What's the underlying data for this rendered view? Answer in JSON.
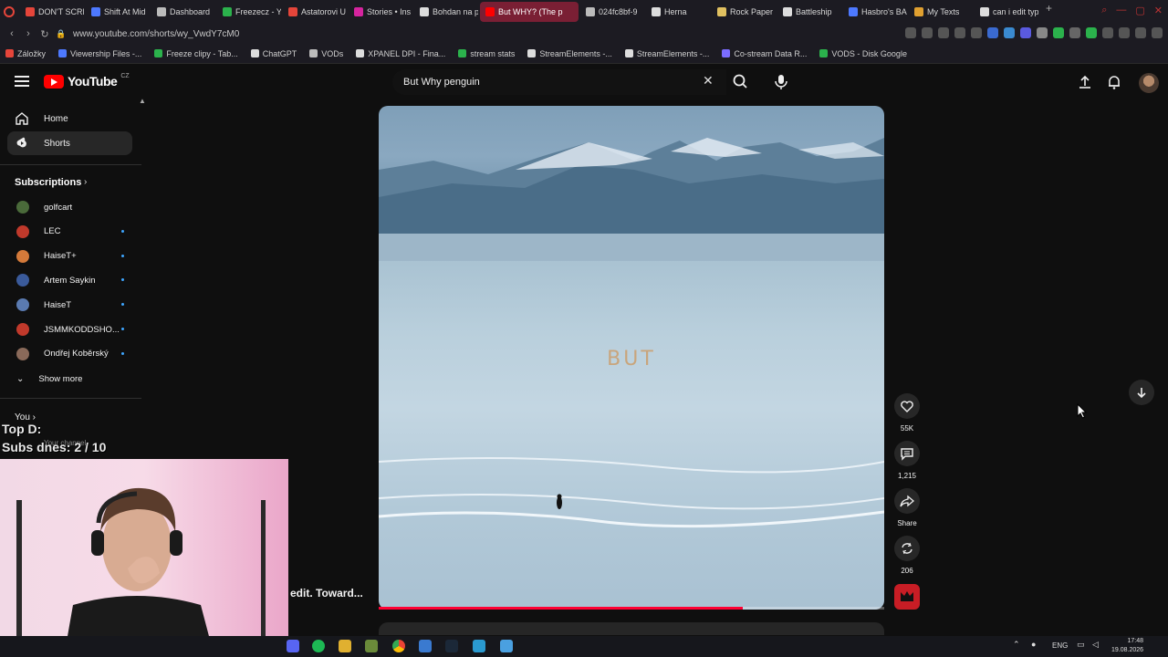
{
  "browser": {
    "tabs": [
      {
        "label": "DON'T SCRE",
        "color": "#e5453a"
      },
      {
        "label": "Shift At Mid",
        "color": "#4d79ff"
      },
      {
        "label": "Dashboard",
        "color": "#bbbbbb"
      },
      {
        "label": "Freezecz - Y",
        "color": "#2bb24c"
      },
      {
        "label": "Astatorovi U",
        "color": "#e5453a"
      },
      {
        "label": "Stories • Ins",
        "color": "#d6249f"
      },
      {
        "label": "Bohdan na p",
        "color": "#dddddd"
      },
      {
        "label": "But WHY? (The p",
        "color": "#ff0000",
        "active": true
      },
      {
        "label": "024fc8bf-9",
        "color": "#bbbbbb"
      },
      {
        "label": "Herna",
        "color": "#dddddd"
      },
      {
        "label": "Rock Paper",
        "color": "#e0c060"
      },
      {
        "label": "Battleship",
        "color": "#dddddd"
      },
      {
        "label": "Hasbro's BA",
        "color": "#4d79ff"
      },
      {
        "label": "My Texts",
        "color": "#e0a030"
      },
      {
        "label": "can i edit typ",
        "color": "#dddddd"
      }
    ],
    "url": "www.youtube.com/shorts/wy_VwdY7cM0",
    "bookmarks": [
      {
        "label": "Záložky",
        "color": "#e5453a"
      },
      {
        "label": "Viewership Files -...",
        "color": "#4d79ff"
      },
      {
        "label": "Freeze clipy - Tab...",
        "color": "#2bb24c"
      },
      {
        "label": "ChatGPT",
        "color": "#dddddd"
      },
      {
        "label": "VODs",
        "color": "#bbbbbb"
      },
      {
        "label": "XPANEL DPI - Fina...",
        "color": "#dddddd"
      },
      {
        "label": "stream stats",
        "color": "#2bb24c"
      },
      {
        "label": "StreamElements -...",
        "color": "#dddddd"
      },
      {
        "label": "StreamElements -...",
        "color": "#dddddd"
      },
      {
        "label": "Co-stream Data R...",
        "color": "#7b6cff"
      },
      {
        "label": "VODS - Disk Google",
        "color": "#2bb24c"
      }
    ]
  },
  "youtube": {
    "logo_text": "YouTube",
    "logo_region": "CZ",
    "search_value": "But Why penguin",
    "sidebar": {
      "items": [
        {
          "label": "Home",
          "icon": "home-icon"
        },
        {
          "label": "Shorts",
          "icon": "shorts-icon",
          "active": true
        }
      ],
      "subscriptions_title": "Subscriptions",
      "subscriptions": [
        {
          "label": "golfcart",
          "color": "#4a6a3a",
          "dot": false
        },
        {
          "label": "LEC",
          "color": "#c0392b",
          "dot": true
        },
        {
          "label": "HaiseT+",
          "color": "#d47a3a",
          "dot": true
        },
        {
          "label": "Artem Saykin",
          "color": "#3a5a9a",
          "dot": true
        },
        {
          "label": "HaiseT",
          "color": "#5a7ab0",
          "dot": true
        },
        {
          "label": "JSMMKODDSHO...",
          "color": "#c0392b",
          "dot": true
        },
        {
          "label": "Ondřej Koběrský",
          "color": "#8a6a5a",
          "dot": true
        }
      ],
      "show_more": "Show more",
      "you": "You",
      "your_channel": "Your channel"
    },
    "short": {
      "overlay_text": "BUT",
      "progress": 0.72,
      "likes": "55K",
      "comments": "1,215",
      "share": "Share",
      "remix": "206"
    }
  },
  "stream_overlay": {
    "top_line": "Top D:",
    "subs_line": "Subs dnes: 2 / 10",
    "caption": "edit. Toward..."
  },
  "taskbar": {
    "language": "ENG",
    "time": "17:48",
    "date": "19.08.2026"
  }
}
